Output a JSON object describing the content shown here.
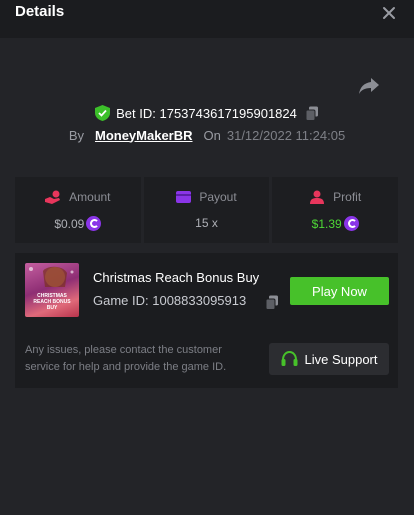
{
  "header": {
    "title": "Details"
  },
  "bet": {
    "id_label": "Bet ID: 1753743617195901824",
    "by_label": "By",
    "user": "MoneyMakerBR",
    "on_label": "On",
    "date": "31/12/2022 11:24:05"
  },
  "stats": [
    {
      "label": "Amount",
      "value": "$0.09",
      "icon": "coins-hand-icon",
      "color": "#e8365c",
      "coin": true
    },
    {
      "label": "Payout",
      "value": "15 x",
      "icon": "wallet-card-icon",
      "color": "#8a35e8",
      "coin": false
    },
    {
      "label": "Profit",
      "value": "$1.39",
      "icon": "profit-user-icon",
      "color": "#e8365c",
      "coin": true
    }
  ],
  "game": {
    "thumb_text": "CHRISTMAS REACH BONUS BUY",
    "name": "Christmas Reach Bonus Buy",
    "id_label": "Game ID: 1008833095913",
    "play_label": "Play Now",
    "issue_text": "Any issues, please contact the customer service for help and provide the game ID.",
    "support_label": "Live Support"
  },
  "colors": {
    "background": "#232428",
    "header": "#1b1c1f",
    "accent_green": "#47c12a",
    "profit_green": "#4ed836",
    "coin_purple": "#8a35e8"
  }
}
